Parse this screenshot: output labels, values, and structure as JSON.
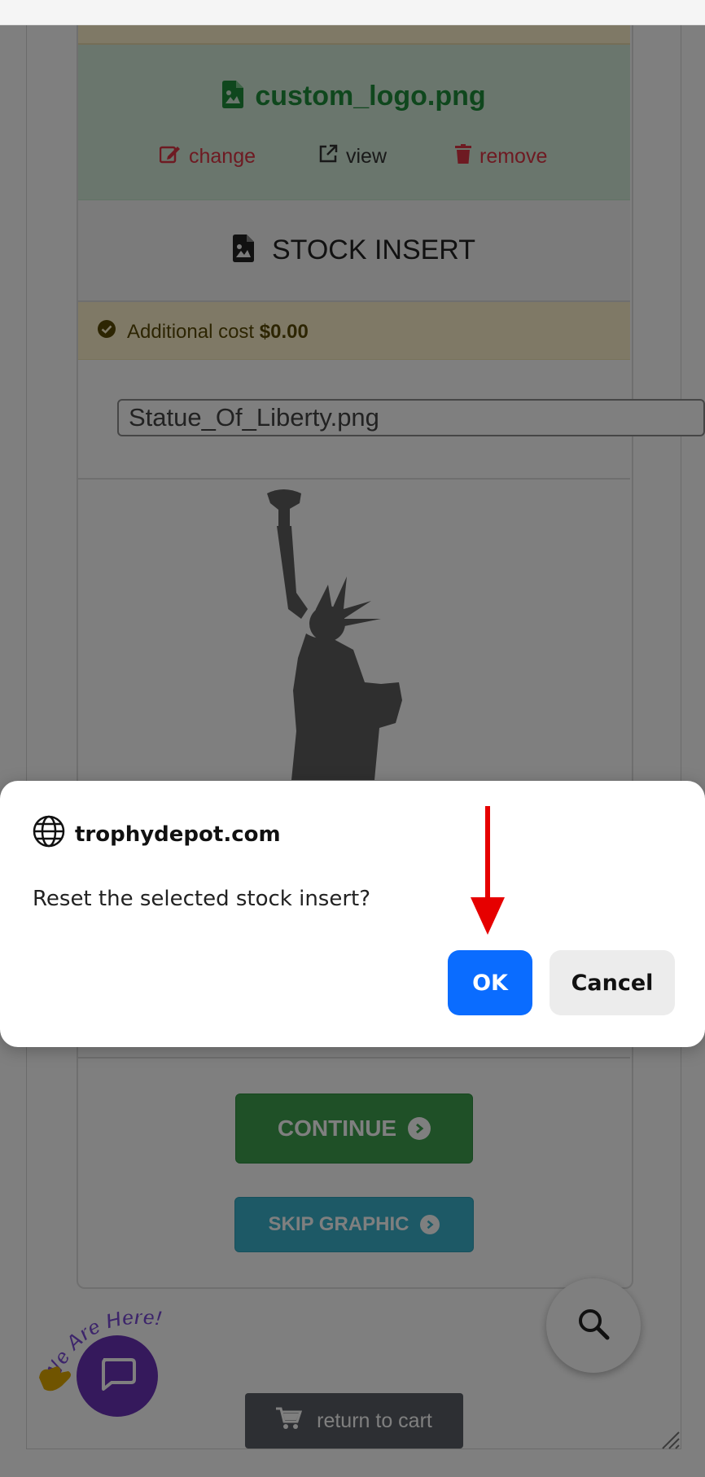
{
  "file_panel": {
    "filename": "custom_logo.png",
    "change_label": "change",
    "view_label": "view",
    "remove_label": "remove"
  },
  "stock_insert": {
    "heading": "STOCK INSERT",
    "cost_label": "Additional cost",
    "cost_value": "$0.00",
    "selected_file": "Statue_Of_Liberty.png"
  },
  "actions": {
    "continue_label": "CONTINUE",
    "skip_label": "SKIP GRAPHIC",
    "return_label": "return to cart"
  },
  "chat": {
    "badge_text": "We Are Here!"
  },
  "dialog": {
    "site": "trophydepot.com",
    "message": "Reset the selected stock insert?",
    "ok_label": "OK",
    "cancel_label": "Cancel"
  },
  "colors": {
    "ok_blue": "#0a6cff",
    "continue_green": "#3ea04f",
    "skip_teal": "#3ab3cc",
    "chat_purple": "#6a32b8",
    "annotation_red": "#e60000"
  }
}
